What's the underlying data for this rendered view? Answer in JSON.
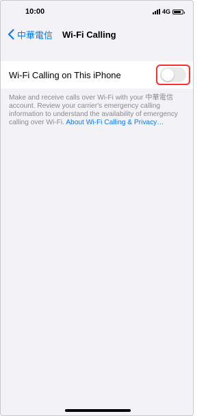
{
  "status_bar": {
    "time": "10:00",
    "network": "4G",
    "battery_level": 0.85
  },
  "nav": {
    "back_label": "中華電信",
    "title": "Wi-Fi Calling"
  },
  "settings": {
    "wifi_calling_label": "Wi-Fi Calling on This iPhone",
    "wifi_calling_enabled": false,
    "footer_text": "Make and receive calls over Wi-Fi with your 中華電信 account. Review your carrier's emergency calling information to understand the availability of emergency calling over Wi-Fi.",
    "footer_link": "About Wi-Fi Calling & Privacy…"
  },
  "colors": {
    "accent": "#0a7aff",
    "highlight": "#ff2d2d",
    "toggle_off": "#e9e9ea"
  }
}
